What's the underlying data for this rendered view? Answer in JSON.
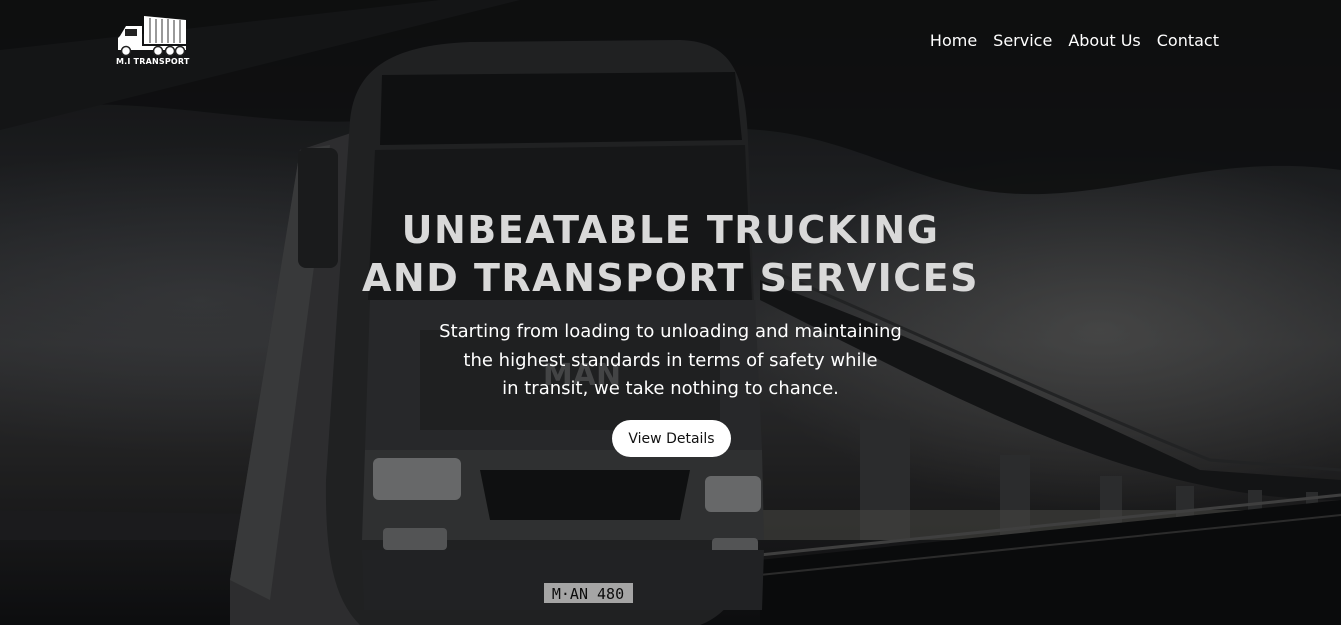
{
  "brand": {
    "logo_icon": "truck-icon",
    "logo_text": "M.I TRANSPORT"
  },
  "nav": {
    "items": [
      {
        "label": "Home"
      },
      {
        "label": "Service"
      },
      {
        "label": "About Us"
      },
      {
        "label": "Contact"
      }
    ]
  },
  "hero": {
    "title_line1": "UNBEATABLE TRUCKING",
    "title_line2": "AND TRANSPORT SERVICES",
    "subtitle_line1": "Starting from loading to unloading and maintaining",
    "subtitle_line2": "the highest standards in terms of safety while",
    "subtitle_line3": "in transit, we take nothing to chance.",
    "cta_label": "View Details",
    "background_image": "truck-under-bridge-photo",
    "plate_text": "M·AN 480",
    "grille_text": "MAN"
  },
  "colors": {
    "title": "#d9d9d9",
    "text": "#ffffff",
    "button_bg": "#ffffff",
    "button_text": "#111111"
  }
}
